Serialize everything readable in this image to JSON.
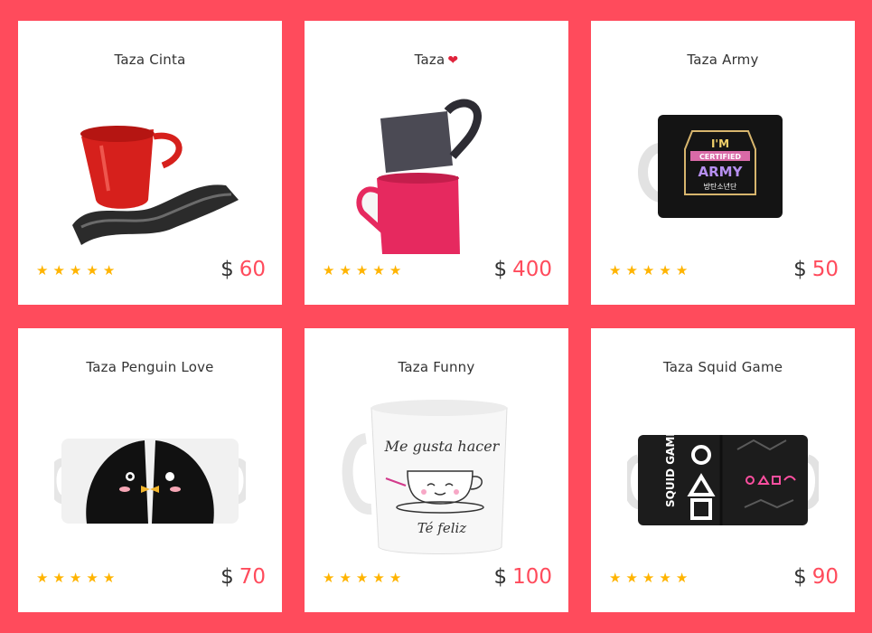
{
  "products": [
    {
      "title": "Taza Cinta",
      "title_heart": "",
      "currency": "$",
      "price": "60",
      "rating": 5,
      "image": "red-ribbon-cup-on-wavy-saucer"
    },
    {
      "title": "Taza",
      "title_heart": "❤",
      "currency": "$",
      "price": "400",
      "rating": 5,
      "image": "stacked-heart-handle-mugs"
    },
    {
      "title": "Taza Army",
      "title_heart": "",
      "currency": "$",
      "price": "50",
      "rating": 5,
      "image": "black-army-mug"
    },
    {
      "title": "Taza Penguin Love",
      "title_heart": "",
      "currency": "$",
      "price": "70",
      "rating": 5,
      "image": "penguin-couple-mugs"
    },
    {
      "title": "Taza Funny",
      "title_heart": "",
      "currency": "$",
      "price": "100",
      "rating": 5,
      "image": "white-funny-mug"
    },
    {
      "title": "Taza Squid Game",
      "title_heart": "",
      "currency": "$",
      "price": "90",
      "rating": 5,
      "image": "squid-game-mug"
    }
  ],
  "mug_texts": {
    "army_line1": "I'M",
    "army_line2": "CERTIFIED",
    "army_line3": "ARMY",
    "army_line4": "방탄소년단",
    "funny_line1": "Me gusta hacer",
    "funny_line2": "Té feliz",
    "squid_logo": "SQUID GAME"
  },
  "colors": {
    "background": "#ff4b5c",
    "price": "#ff4b5c",
    "star": "#ffb400",
    "card": "#ffffff"
  }
}
